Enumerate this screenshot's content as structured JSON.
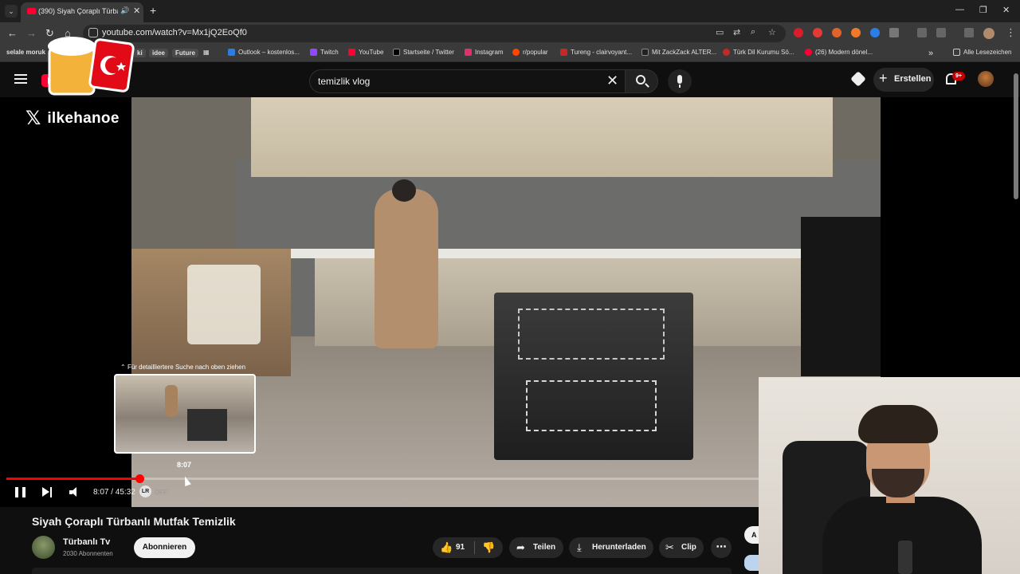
{
  "browser": {
    "tab": {
      "title": "(390) Siyah Çoraplı Türbanlı"
    },
    "url": "youtube.com/watch?v=Mx1jQ2EoQf0",
    "bookmarks": [
      {
        "label": "selale moruk",
        "color": "#ffffff"
      },
      {
        "label": "ki",
        "color": "#444444"
      },
      {
        "label": "idee",
        "color": "#444444"
      },
      {
        "label": "Future",
        "color": "#e06060"
      },
      {
        "label": "Outlook – kostenlos...",
        "color": "#2a7de1"
      },
      {
        "label": "Twitch",
        "color": "#9146ff"
      },
      {
        "label": "YouTube",
        "color": "#ff0033"
      },
      {
        "label": "Startseite / Twitter",
        "color": "#000000"
      },
      {
        "label": "Instagram",
        "color": "#e1306c"
      },
      {
        "label": "r/popular",
        "color": "#ff4500"
      },
      {
        "label": "Tureng - clairvoyant...",
        "color": "#c62828"
      },
      {
        "label": "Mit ZackZack ALTER...",
        "color": "#222222"
      },
      {
        "label": "Türk Dil Kurumu Sö...",
        "color": "#c62828"
      },
      {
        "label": "(26) Modern dönel...",
        "color": "#ff0033"
      }
    ],
    "all_bookmarks": "Alle Lesezeichen"
  },
  "masthead": {
    "search_query": "temizlik vlog",
    "create_label": "Erstellen",
    "notification_count": "9+"
  },
  "overlay": {
    "x_handle": "ilkehanoe"
  },
  "player": {
    "scrub_hint": "Für detailliertere Suche nach oben ziehen",
    "preview_time": "8:07",
    "current_time": "8:07",
    "duration": "45:32",
    "time_display": "8:07 / 45:32",
    "progress_fraction": 0.1772,
    "extension_badge": "LR",
    "extension_state": "OFF",
    "accent_color": "#ff0000"
  },
  "video": {
    "title": "Siyah Çoraplı Türbanlı Mutfak Temizlik",
    "channel": "Türbanlı Tv",
    "subscribers": "2030 Abonnenten",
    "subscribe_label": "Abonnieren",
    "likes": "91",
    "share_label": "Teilen",
    "download_label": "Herunterladen",
    "clip_label": "Clip"
  },
  "side_panel": {
    "a_label": "A"
  }
}
